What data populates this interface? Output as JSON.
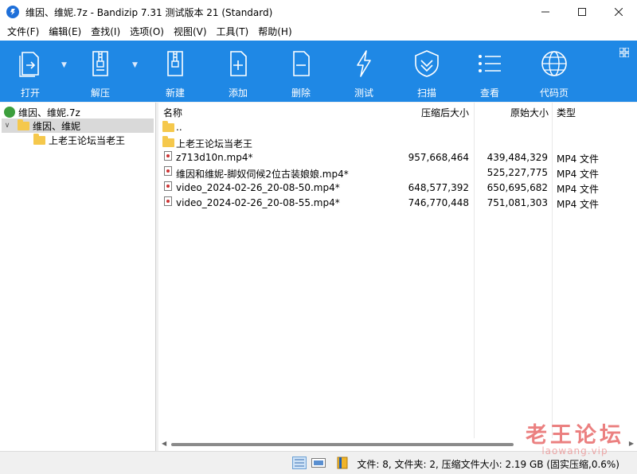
{
  "window": {
    "title": "维因、维妮.7z - Bandizip 7.31 测试版本 21 (Standard)",
    "controls": [
      "minimize",
      "maximize",
      "close"
    ]
  },
  "menu": [
    "文件(F)",
    "编辑(E)",
    "查找(I)",
    "选项(O)",
    "视图(V)",
    "工具(T)",
    "帮助(H)"
  ],
  "toolbar": {
    "buttons": [
      {
        "label": "打开",
        "icon": "open-icon"
      },
      {
        "label": "解压",
        "icon": "extract-icon"
      },
      {
        "label": "新建",
        "icon": "new-archive-icon"
      },
      {
        "label": "添加",
        "icon": "add-icon"
      },
      {
        "label": "删除",
        "icon": "delete-icon"
      },
      {
        "label": "测试",
        "icon": "test-icon"
      },
      {
        "label": "扫描",
        "icon": "scan-icon"
      },
      {
        "label": "查看",
        "icon": "view-icon"
      },
      {
        "label": "代码页",
        "icon": "codepage-icon"
      }
    ],
    "background": "#1f88e5"
  },
  "tree": {
    "root": "维因、维妮.7z",
    "folder": "维因、维妮",
    "subfolder": "上老王论坛当老王"
  },
  "list": {
    "columns": [
      "名称",
      "压缩后大小",
      "原始大小",
      "类型"
    ],
    "rows": [
      {
        "name": "..",
        "packed": "",
        "size": "",
        "type": "",
        "kind": "folder"
      },
      {
        "name": "上老王论坛当老王",
        "packed": "",
        "size": "",
        "type": "",
        "kind": "folder"
      },
      {
        "name": "z713d10n.mp4*",
        "packed": "957,668,464",
        "size": "439,484,329",
        "type": "MP4 文件",
        "kind": "file"
      },
      {
        "name": "维因和维妮-脚奴伺候2位古装娘娘.mp4*",
        "packed": "",
        "size": "525,227,775",
        "type": "MP4 文件",
        "kind": "file"
      },
      {
        "name": "video_2024-02-26_20-08-50.mp4*",
        "packed": "648,577,392",
        "size": "650,695,682",
        "type": "MP4 文件",
        "kind": "file"
      },
      {
        "name": "video_2024-02-26_20-08-55.mp4*",
        "packed": "746,770,448",
        "size": "751,081,303",
        "type": "MP4 文件",
        "kind": "file"
      }
    ]
  },
  "status": {
    "text": "文件: 8, 文件夹: 2, 压缩文件大小: 2.19 GB (固实压缩,0.6%)"
  },
  "watermark": {
    "main": "老王论坛",
    "sub": "laowang.vip"
  }
}
